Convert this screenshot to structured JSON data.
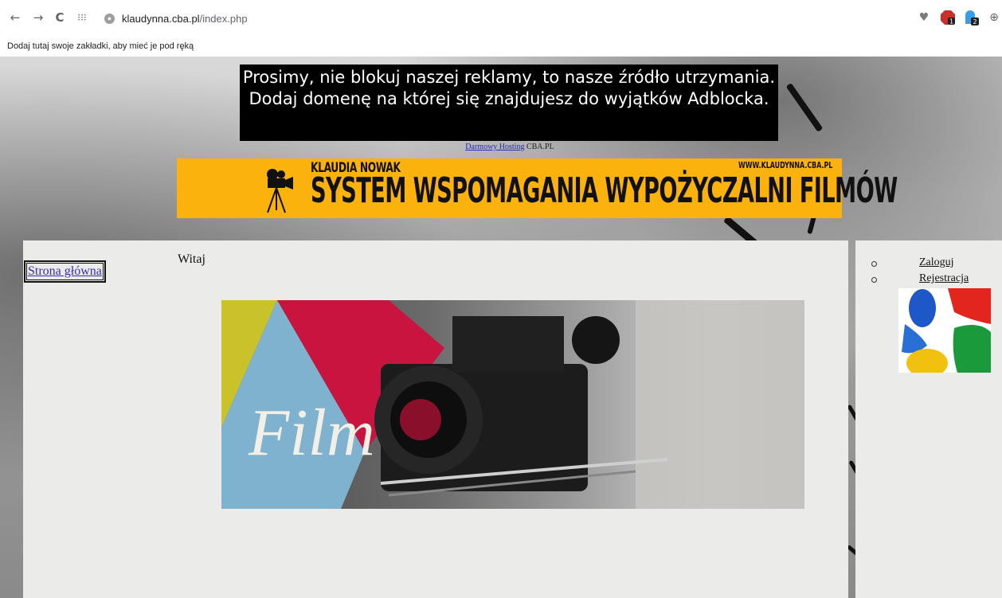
{
  "browser": {
    "url_host": "klaudynna.cba.pl",
    "url_path": "/index.php",
    "url_prefix": "",
    "bookmarks_hint": "Dodaj tutaj swoje zakładki, aby mieć je pod ręką",
    "extensions": [
      {
        "icon": "heart-icon"
      },
      {
        "icon": "adblock-plus-icon",
        "badge": "1"
      },
      {
        "icon": "ghostery-icon",
        "badge": "2"
      }
    ]
  },
  "page": {
    "adblock_message": "Prosimy, nie blokuj naszej reklamy, to nasze źródło utrzymania. Dodaj domenę na której się znajdujesz do wyjątków Adblocka.",
    "hosting_link": "Darmowy Hosting",
    "hosting_suffix": "CBA.PL",
    "banner": {
      "author": "KLAUDIA NOWAK",
      "website": "WWW.KLAUDYNNA.CBA.PL",
      "title": "SYSTEM WSPOMAGANIA WYPOŻYCZALNI FILMÓW",
      "background": "#fbb20d"
    },
    "nav": {
      "home": "Strona główna"
    },
    "welcome": "Witaj",
    "film_word": "Film",
    "side_menu": [
      {
        "label": "Zaloguj"
      },
      {
        "label": "Rejestracja"
      }
    ]
  }
}
